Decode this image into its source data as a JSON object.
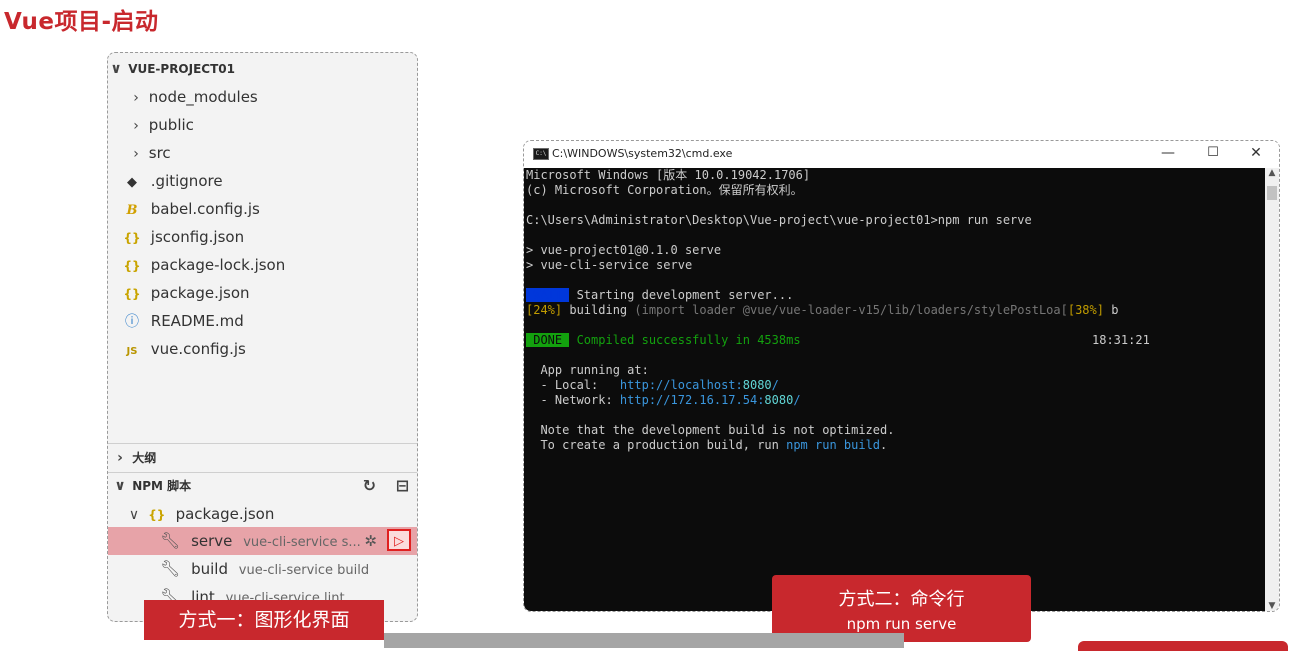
{
  "page_title": "Vue项目-启动",
  "explorer": {
    "project_name": "VUE-PROJECT01",
    "items": [
      {
        "label": "node_modules",
        "icon": "chevron-right"
      },
      {
        "label": "public",
        "icon": "chevron-right"
      },
      {
        "label": "src",
        "icon": "chevron-right"
      },
      {
        "label": ".gitignore",
        "icon": "git-icon"
      },
      {
        "label": "babel.config.js",
        "icon": "babel-icon"
      },
      {
        "label": "jsconfig.json",
        "icon": "json-icon"
      },
      {
        "label": "package-lock.json",
        "icon": "json-icon"
      },
      {
        "label": "package.json",
        "icon": "json-icon"
      },
      {
        "label": "README.md",
        "icon": "info-icon"
      },
      {
        "label": "vue.config.js",
        "icon": "js-icon"
      }
    ],
    "icon_glyphs": {
      "git": "◆",
      "babel": "B",
      "json": "{}",
      "info": "ⓘ",
      "js": "JS"
    },
    "outline_label": "大纲",
    "npm_section_label": "NPM 脚本",
    "npm_package": "package.json",
    "scripts": [
      {
        "name": "serve",
        "command": "vue-cli-service s...",
        "selected": true
      },
      {
        "name": "build",
        "command": "vue-cli-service build",
        "selected": false
      },
      {
        "name": "lint",
        "command": "vue-cli-service lint",
        "selected": false
      }
    ]
  },
  "label_one": "方式一：图形化界面",
  "label_two": {
    "line1": "方式二：命令行",
    "line2": "npm run serve"
  },
  "cmd_window": {
    "title": "C:\\WINDOWS\\system32\\cmd.exe",
    "controls": {
      "minimize": "—",
      "maximize": "☐",
      "close": "✕"
    },
    "lines": {
      "l1": "Microsoft Windows [版本 10.0.19042.1706]",
      "l2": "(c) Microsoft Corporation。保留所有权利。",
      "l3": "C:\\Users\\Administrator\\Desktop\\Vue-project\\vue-project01>npm run serve",
      "l4": "> vue-project01@0.1.0 serve",
      "l5": "> vue-cli-service serve",
      "wait_badge": " WAIT ",
      "l6": " Starting development server...",
      "l7_pct": "[24%]",
      "l7_building": " building ",
      "l7_rest": "(import loader @vue/vue-loader-v15/lib/loaders/stylePostLoa[",
      "l7_pct2": "[38%]",
      "l7_end": " b",
      "done_badge": " DONE ",
      "l8": " Compiled successfully in 4538ms",
      "l8_time": "18:31:21",
      "l9": "  App running at:",
      "l10_label": "  - Local:   ",
      "l10_url": "http://localhost:",
      "l10_port": "8080",
      "l10_slash": "/",
      "l11_label": "  - Network: ",
      "l11_url": "http://172.16.17.54:",
      "l11_port": "8080",
      "l11_slash": "/",
      "l12": "  Note that the development build is not optimized.",
      "l13_a": "  To create a production build, run ",
      "l13_cmd": "npm run build",
      "l13_b": "."
    }
  },
  "colors": {
    "accent_red": "#c8282d",
    "console_bg": "#0c0c0c"
  }
}
